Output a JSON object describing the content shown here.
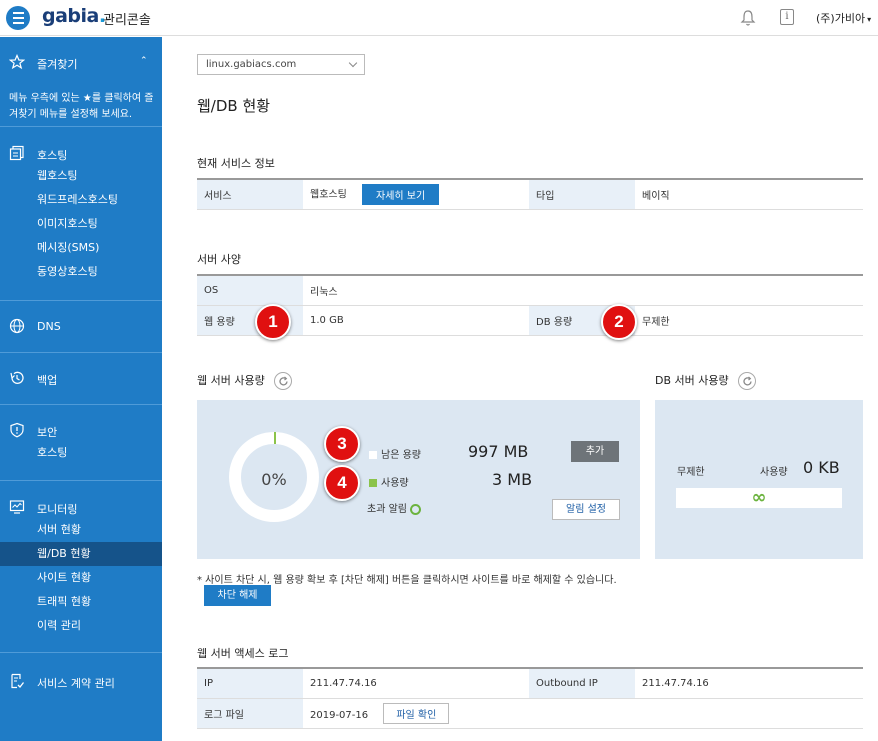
{
  "header": {
    "logo_text": "gabia",
    "logo_dot": ".",
    "console_title": "관리콘솔",
    "account_name": "(주)가비아",
    "account_caret": "▾",
    "info_icon_glyph": "i",
    "chevron_up_glyph": "⌃"
  },
  "sidebar": {
    "favorites_label": "즐겨찾기",
    "favorites_desc": "메뉴 우측에 있는 ★를 클릭하여 즐겨찾기 메뉴를 설정해 보세요.",
    "hosting": {
      "label": "호스팅",
      "items": [
        "웹호스팅",
        "워드프레스호스팅",
        "이미지호스팅",
        "메시징(SMS)",
        "동영상호스팅"
      ]
    },
    "dns_label": "DNS",
    "backup_label": "백업",
    "security": {
      "label": "보안",
      "items": [
        "호스팅"
      ]
    },
    "monitoring": {
      "label": "모니터링",
      "items": [
        "서버 현황",
        "웹/DB 현황",
        "사이트 현황",
        "트래픽 현황",
        "이력 관리"
      ],
      "active_index": 1
    },
    "contract_label": "서비스 계약 관리"
  },
  "main": {
    "server_select": "linux.gabiacs.com",
    "page_title": "웹/DB 현황",
    "current_service": {
      "title": "현재 서비스 정보",
      "service_label": "서비스",
      "service_value": "웹호스팅",
      "detail_button": "자세히 보기",
      "type_label": "타입",
      "type_value": "베이직"
    },
    "server_spec": {
      "title": "서버 사양",
      "os_label": "OS",
      "os_value": "리눅스",
      "web_label": "웹 용량",
      "web_value": "1.0 GB",
      "db_label": "DB 용량",
      "db_value": "무제한"
    },
    "web_usage": {
      "title": "웹 서버 사용량",
      "percent": "0%",
      "used_fraction": 0.0,
      "remain_label": "남은 용량",
      "remain_value": "997 MB",
      "used_label": "사용량",
      "used_value": "3 MB",
      "over_alert_label": "초과 알림",
      "add_button": "추가",
      "alert_button": "알림 설정",
      "remain_color": "#ffffff",
      "used_color": "#8bc34a"
    },
    "db_usage": {
      "title": "DB 서버 사용량",
      "unlimited": "무제한",
      "usage_label": "사용량",
      "usage_value": "0 KB",
      "infinity_glyph": "∞"
    },
    "notice": "* 사이트 차단 시, 웹 용량 확보 후 [차단 해제] 버튼을 클릭하시면 사이트를 바로 해제할 수 있습니다.",
    "unblock_button": "차단 해제",
    "access_log": {
      "title": "웹 서버 액세스 로그",
      "ip_label": "IP",
      "ip_value": "211.47.74.16",
      "outbound_label": "Outbound IP",
      "outbound_value": "211.47.74.16",
      "file_label": "로그 파일",
      "file_date": "2019-07-16",
      "file_button": "파일 확인"
    }
  },
  "markers": [
    "1",
    "2",
    "3",
    "4"
  ],
  "colors": {
    "brand": "#1f7cc6",
    "sidebar_active": "#15538a",
    "panel_bg": "#dce7f2",
    "marker": "#e01010"
  }
}
